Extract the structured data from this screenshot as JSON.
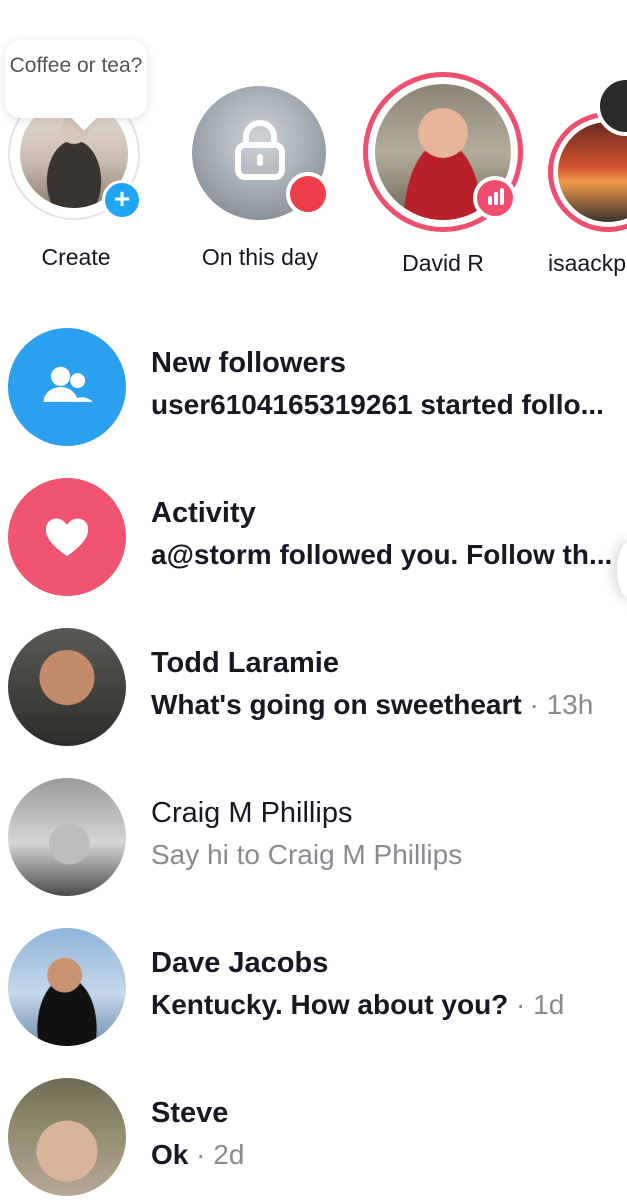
{
  "stories": {
    "create": {
      "label": "Create",
      "bubble_text": "Coffee or tea?",
      "badge_icon": "plus-icon"
    },
    "on_this_day": {
      "label": "On this day",
      "icon": "lock-icon"
    },
    "david": {
      "label": "David R",
      "badge_icon": "live-bars-icon"
    },
    "isaac": {
      "label": "isaackp"
    }
  },
  "inbox": [
    {
      "name": "New followers",
      "preview": "user6104165319261 started follo...",
      "time": "",
      "icon": "followers-icon",
      "color": "#2ba0ef",
      "bold": true
    },
    {
      "name": "Activity",
      "preview": "a@storm followed you. Follow th...",
      "time": "",
      "icon": "heart-icon",
      "color": "#f05470",
      "bold": true
    },
    {
      "name": "Todd Laramie",
      "preview": "What's going on sweetheart",
      "time": "13h",
      "bold": true
    },
    {
      "name": "Craig M Phillips",
      "preview": "Say hi to Craig M Phillips",
      "time": "",
      "bold": false
    },
    {
      "name": "Dave Jacobs",
      "preview": "Kentucky. How about you?",
      "time": "1d",
      "bold": true
    },
    {
      "name": "Steve",
      "preview": "Ok",
      "time": "2d",
      "bold": true
    }
  ],
  "time_separator": " · ",
  "colors": {
    "accent_pink": "#ef4e6f",
    "accent_blue": "#20a6f5",
    "red_dot": "#ee3d4b",
    "muted_text": "#8a8b91"
  }
}
